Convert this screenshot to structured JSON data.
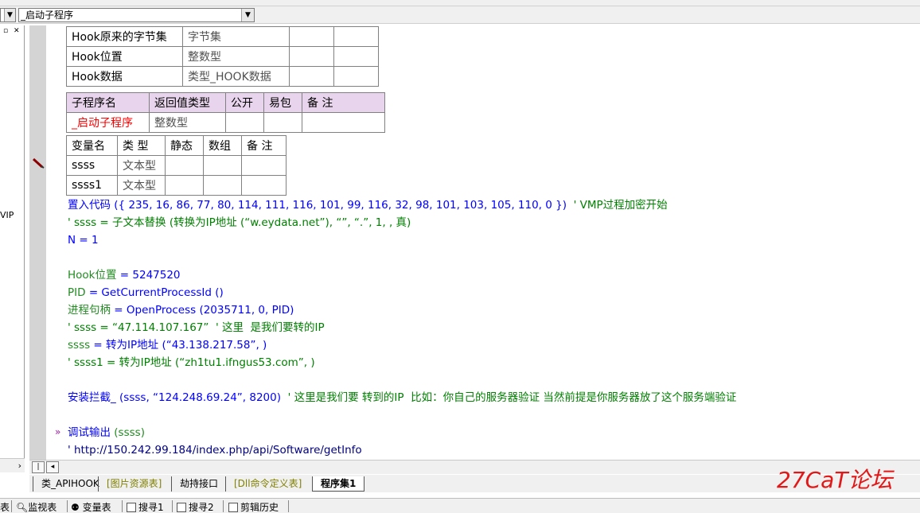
{
  "toolbar": {
    "dropdown_value": "_启动子程序"
  },
  "leftpanel": {
    "buttons": "▫ ✕",
    "fragment": "VIP"
  },
  "var_table1": {
    "rows": [
      {
        "name": "Hook原来的字节集",
        "type": "字节集"
      },
      {
        "name": "Hook位置",
        "type": "整数型"
      },
      {
        "name": "Hook数据",
        "type": "类型_HOOK数据"
      }
    ]
  },
  "sub_table": {
    "headers": [
      "子程序名",
      "返回值类型",
      "公开",
      "易包",
      "备 注"
    ],
    "name": "_启动子程序",
    "return_type": "整数型"
  },
  "local_table": {
    "headers": [
      "变量名",
      "类 型",
      "静态",
      "数组",
      "备 注"
    ],
    "rows": [
      {
        "name": "ssss",
        "type": "文本型"
      },
      {
        "name": "ssss1",
        "type": "文本型"
      }
    ]
  },
  "code": {
    "l1_a": "置入代码",
    "l1_b": " ({ 235, 16, 86, 77, 80, 114, 111, 116, 101, 99, 116, 32, 98, 101, 103, 105, 110, 0 })  ",
    "l1_c": "' VMP过程加密开始",
    "l2": "' ssss = 子文本替换 (转换为IP地址 (“w.eydata.net”), “”, “.”, 1, , 真)",
    "l3": "N = 1",
    "l4_a": "Hook位置",
    "l4_b": " = 5247520",
    "l5_a": "PID",
    "l5_b": " = GetCurrentProcessId ()",
    "l6_a": "进程句柄",
    "l6_b": " = OpenProcess (2035711, 0, PID)",
    "l7": "' ssss = “47.114.107.167”  ' 这里  是我们要转的IP",
    "l8_a": "ssss",
    "l8_b": " = 转为IP地址 (“43.138.217.58”, )",
    "l9": "' ssss1 = 转为IP地址 (“zh1tu1.ifngus53.com”, )",
    "l10_a": "安装拦截_",
    "l10_b": " (ssss, “124.248.69.24”, 8200)  ",
    "l10_c": "' 这里是我们要 转到的IP  比如：你自己的服务器验证 当然前提是你服务器放了这个服务端验证",
    "l11_a": "调试输出",
    "l11_b": " (ssss)",
    "l12": "' http://150.242.99.184/index.php/api/Software/getInfo",
    "arrow": "»"
  },
  "tabs": [
    "类_APIHOOK",
    "[图片资源表]",
    "劫持接口",
    "[Dll命令定义表]",
    "程序集1"
  ],
  "bottombar": [
    "表",
    "监视表",
    "变量表",
    "搜寻1",
    "搜寻2",
    "剪辑历史"
  ],
  "watermark": "27CaT论坛"
}
